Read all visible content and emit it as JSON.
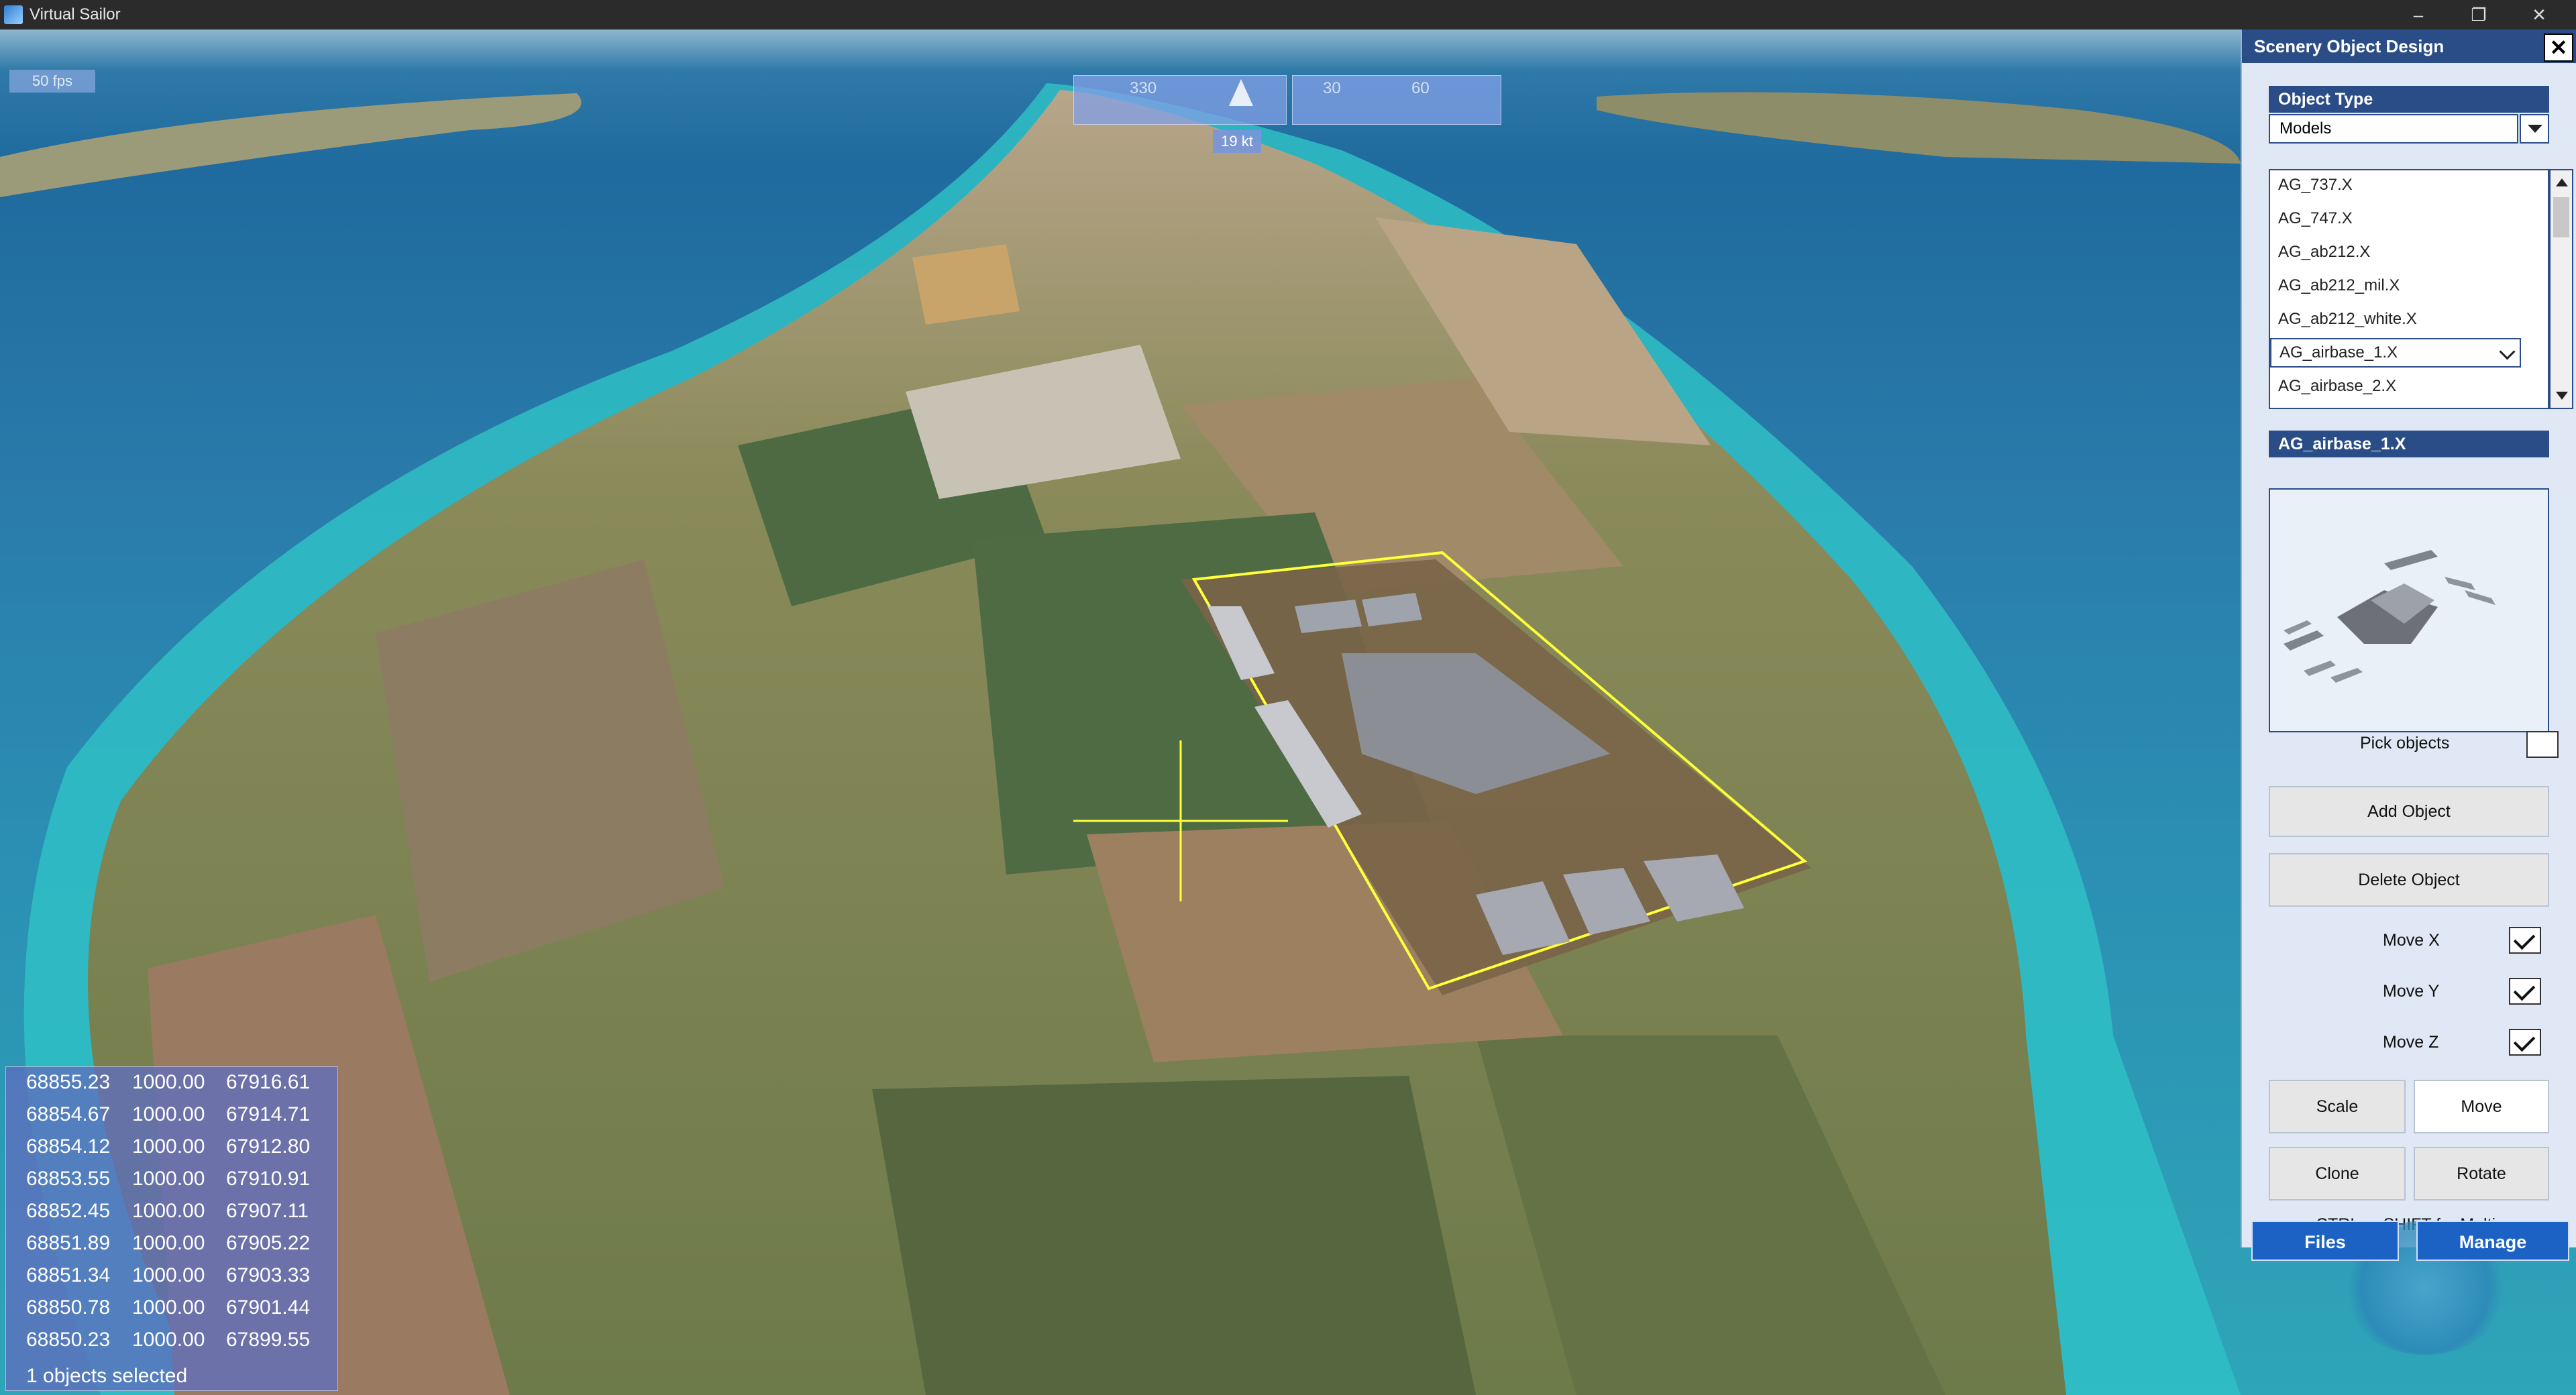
{
  "window": {
    "title": "Virtual Sailor"
  },
  "hud": {
    "fps": "50 fps",
    "heading_labels": [
      "330",
      "30",
      "60"
    ],
    "speed": "19 kt"
  },
  "coordinates": {
    "rows": [
      [
        "68855.23",
        "1000.00",
        "67916.61"
      ],
      [
        "68854.67",
        "1000.00",
        "67914.71"
      ],
      [
        "68854.12",
        "1000.00",
        "67912.80"
      ],
      [
        "68853.55",
        "1000.00",
        "67910.91"
      ],
      [
        "68852.45",
        "1000.00",
        "67907.11"
      ],
      [
        "68851.89",
        "1000.00",
        "67905.22"
      ],
      [
        "68851.34",
        "1000.00",
        "67903.33"
      ],
      [
        "68850.78",
        "1000.00",
        "67901.44"
      ],
      [
        "68850.23",
        "1000.00",
        "67899.55"
      ]
    ],
    "status": "1 objects selected"
  },
  "panel": {
    "title": "Scenery Object Design",
    "close": "✕",
    "object_type_label": "Object Type",
    "object_type_value": "Models",
    "objects": [
      "AG_737.X",
      "AG_747.X",
      "AG_ab212.X",
      "AG_ab212_mil.X",
      "AG_ab212_white.X",
      "AG_airbase_1.X",
      "AG_airbase_2.X"
    ],
    "selected_object": "AG_airbase_1.X",
    "preview_title": "AG_airbase_1.X",
    "pick_objects_label": "Pick objects",
    "add_object": "Add Object",
    "delete_object": "Delete Object",
    "move_x_label": "Move X",
    "move_y_label": "Move Y",
    "move_z_label": "Move Z",
    "scale": "Scale",
    "move": "Move",
    "clone": "Clone",
    "rotate": "Rotate",
    "hint": "CTRL or SHIFT for Multi",
    "tab_files": "Files",
    "tab_manage": "Manage"
  },
  "colors": {
    "panel_header": "#2b4d87",
    "tab": "#1c62c5",
    "sea": "#1f6a9e",
    "shallow_water": "#2fc0c6"
  }
}
